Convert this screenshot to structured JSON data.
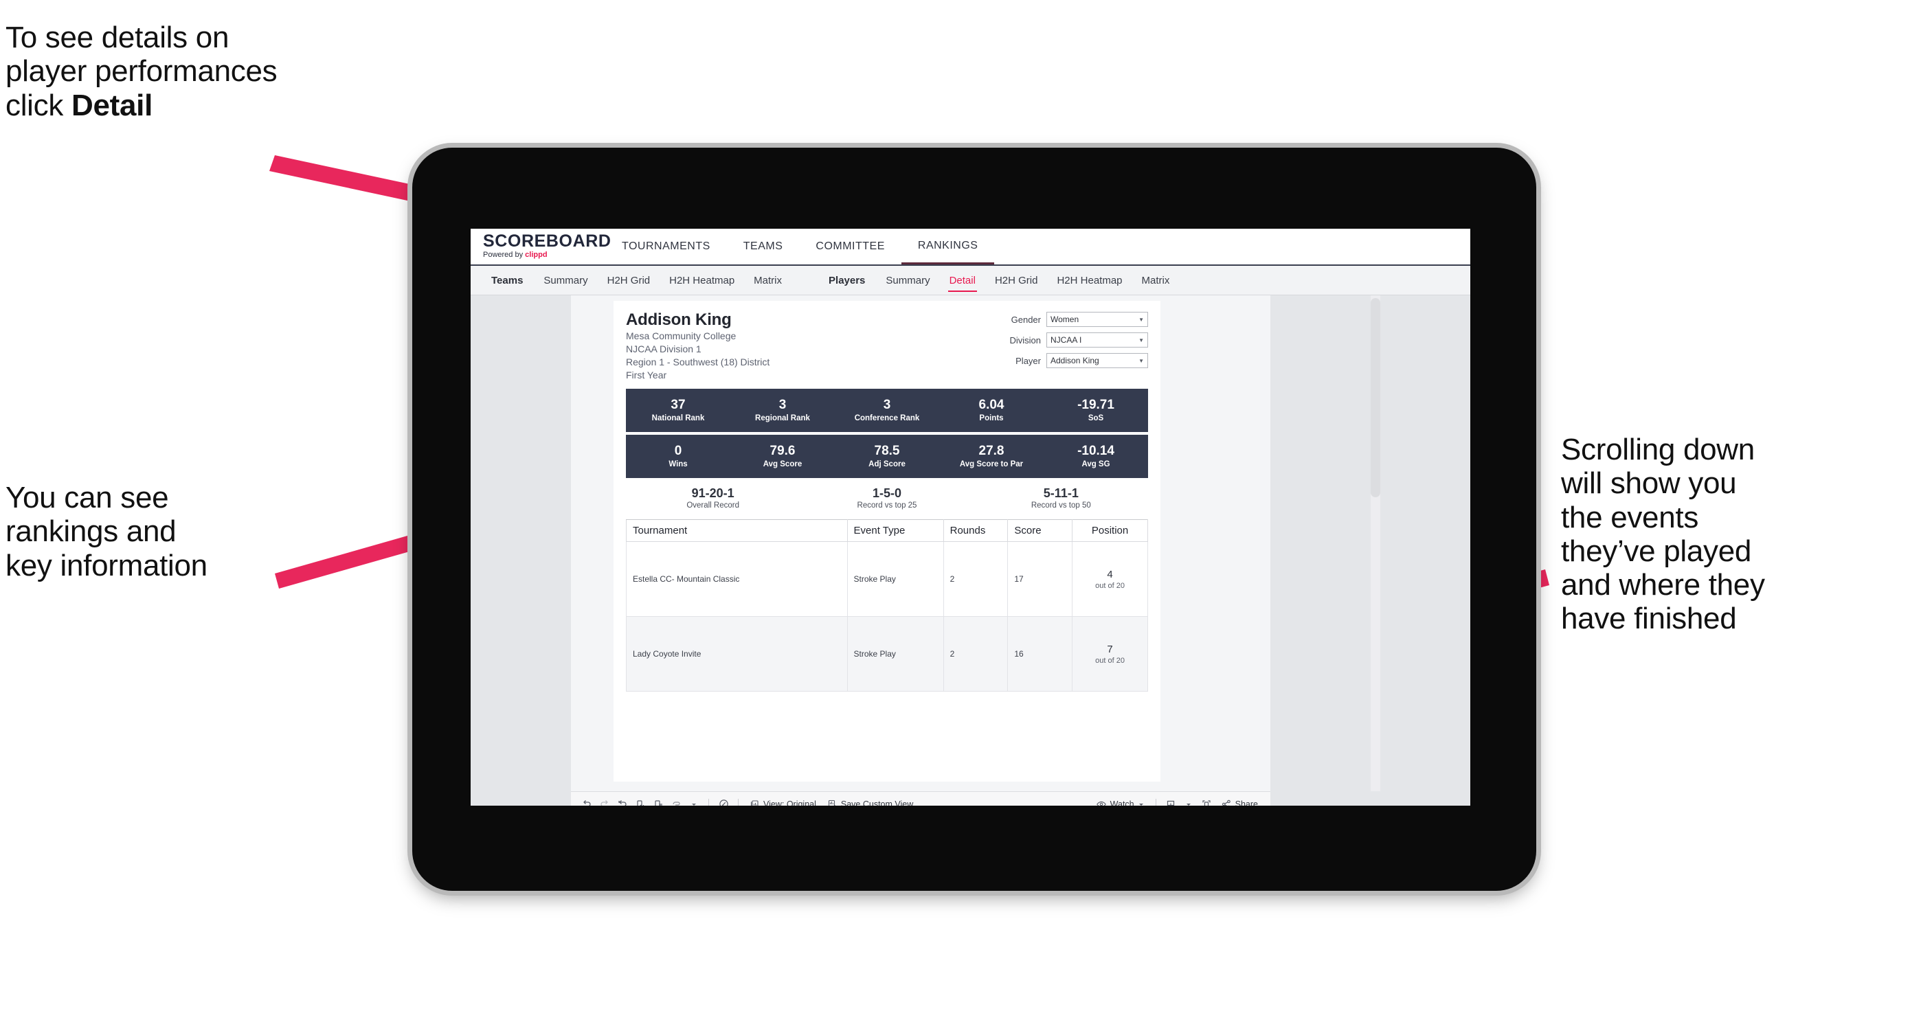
{
  "annotations": {
    "top": {
      "before": "To see details on\nplayer performances\nclick ",
      "bold": "Detail"
    },
    "left": {
      "text": "You can see\nrankings and\nkey information"
    },
    "right": {
      "text": "Scrolling down\nwill show you\nthe events\nthey’ve played\nand where they\nhave finished"
    }
  },
  "colors": {
    "accent": "#e8194f",
    "band": "#343b4f",
    "page_bg": "#e4e6e9",
    "arrow": "#e8275c"
  },
  "brand": {
    "title": "SCOREBOARD",
    "powered_prefix": "Powered by ",
    "powered_name": "clippd"
  },
  "topnav": [
    {
      "label": "TOURNAMENTS",
      "active": false
    },
    {
      "label": "TEAMS",
      "active": false
    },
    {
      "label": "COMMITTEE",
      "active": false
    },
    {
      "label": "RANKINGS",
      "active": true
    }
  ],
  "subnav": {
    "teams_group_label": "Teams",
    "teams_tabs": [
      {
        "label": "Summary",
        "active": false
      },
      {
        "label": "H2H Grid",
        "active": false
      },
      {
        "label": "H2H Heatmap",
        "active": false
      },
      {
        "label": "Matrix",
        "active": false
      }
    ],
    "players_group_label": "Players",
    "players_tabs": [
      {
        "label": "Summary",
        "active": false
      },
      {
        "label": "Detail",
        "active": true
      },
      {
        "label": "H2H Grid",
        "active": false
      },
      {
        "label": "H2H Heatmap",
        "active": false
      },
      {
        "label": "Matrix",
        "active": false
      }
    ]
  },
  "player": {
    "name": "Addison King",
    "school": "Mesa Community College",
    "division": "NJCAA Division 1",
    "region": "Region 1 - Southwest (18) District",
    "class_year": "First Year"
  },
  "filters": [
    {
      "label": "Gender",
      "value": "Women"
    },
    {
      "label": "Division",
      "value": "NJCAA I"
    },
    {
      "label": "Player",
      "value": "Addison King"
    }
  ],
  "stats_band_1": [
    {
      "value": "37",
      "label": "National Rank"
    },
    {
      "value": "3",
      "label": "Regional Rank"
    },
    {
      "value": "3",
      "label": "Conference Rank"
    },
    {
      "value": "6.04",
      "label": "Points"
    },
    {
      "value": "-19.71",
      "label": "SoS"
    }
  ],
  "stats_band_2": [
    {
      "value": "0",
      "label": "Wins"
    },
    {
      "value": "79.6",
      "label": "Avg Score"
    },
    {
      "value": "78.5",
      "label": "Adj Score"
    },
    {
      "value": "27.8",
      "label": "Avg Score to Par"
    },
    {
      "value": "-10.14",
      "label": "Avg SG"
    }
  ],
  "records": [
    {
      "value": "91-20-1",
      "label": "Overall Record"
    },
    {
      "value": "1-5-0",
      "label": "Record vs top 25"
    },
    {
      "value": "5-11-1",
      "label": "Record vs top 50"
    }
  ],
  "table": {
    "headers": [
      "Tournament",
      "Event Type",
      "Rounds",
      "Score",
      "Position"
    ],
    "rows": [
      {
        "tournament": "Estella CC- Mountain Classic",
        "event_type": "Stroke Play",
        "rounds": "2",
        "score": "17",
        "position": "4",
        "position_sub": "out of 20"
      },
      {
        "tournament": "Lady Coyote Invite",
        "event_type": "Stroke Play",
        "rounds": "2",
        "score": "16",
        "position": "7",
        "position_sub": "out of 20"
      }
    ]
  },
  "toolbar": {
    "view_label": "View: Original",
    "save_label": "Save Custom View",
    "watch_label": "Watch",
    "share_label": "Share"
  }
}
